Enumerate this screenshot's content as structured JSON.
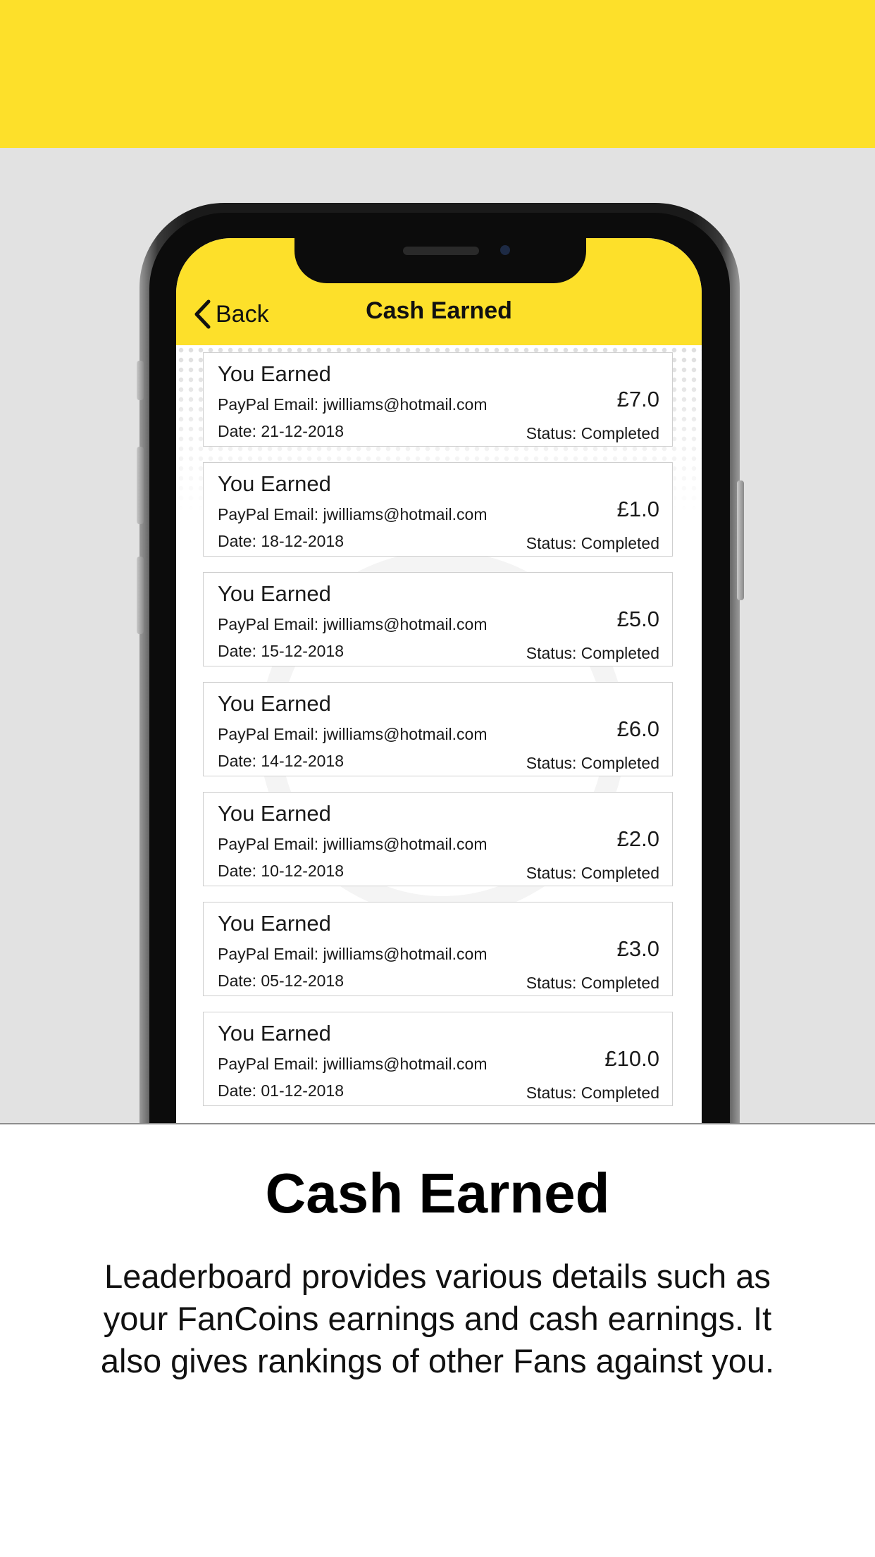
{
  "app": {
    "back_label": "Back",
    "title": "Cash Earned"
  },
  "entries": [
    {
      "title": "You Earned",
      "email": "PayPal Email: jwilliams@hotmail.com",
      "date": "Date: 21-12-2018",
      "amount": "£7.0",
      "status": "Status: Completed"
    },
    {
      "title": "You Earned",
      "email": "PayPal Email: jwilliams@hotmail.com",
      "date": "Date: 18-12-2018",
      "amount": "£1.0",
      "status": "Status: Completed"
    },
    {
      "title": "You Earned",
      "email": "PayPal Email: jwilliams@hotmail.com",
      "date": "Date: 15-12-2018",
      "amount": "£5.0",
      "status": "Status: Completed"
    },
    {
      "title": "You Earned",
      "email": "PayPal Email: jwilliams@hotmail.com",
      "date": "Date: 14-12-2018",
      "amount": "£6.0",
      "status": "Status: Completed"
    },
    {
      "title": "You Earned",
      "email": "PayPal Email: jwilliams@hotmail.com",
      "date": "Date: 10-12-2018",
      "amount": "£2.0",
      "status": "Status: Completed"
    },
    {
      "title": "You Earned",
      "email": "PayPal Email: jwilliams@hotmail.com",
      "date": "Date: 05-12-2018",
      "amount": "£3.0",
      "status": "Status: Completed"
    },
    {
      "title": "You Earned",
      "email": "PayPal Email: jwilliams@hotmail.com",
      "date": "Date: 01-12-2018",
      "amount": "£10.0",
      "status": "Status: Completed"
    }
  ],
  "caption": {
    "title": "Cash Earned",
    "body": "Leaderboard provides various details such as your FanCoins earnings and cash earnings. It also gives rankings of other Fans against you."
  },
  "colors": {
    "brand_yellow": "#fde02a",
    "backdrop_gray": "#e2e2e2"
  },
  "icons": {
    "back": "chevron-left-icon"
  }
}
